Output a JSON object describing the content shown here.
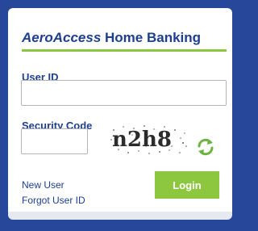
{
  "header": {
    "brand": "AeroAccess",
    "title_rest": " Home Banking"
  },
  "form": {
    "user_id_label": "User ID",
    "user_id_value": "",
    "security_code_label": "Security Code",
    "security_code_value": "",
    "captcha_text": "n2h8"
  },
  "links": {
    "new_user": "New User",
    "forgot_user_id": "Forgot User ID"
  },
  "actions": {
    "login_label": "Login"
  },
  "icons": {
    "refresh": "refresh-icon"
  },
  "colors": {
    "background": "#27479a",
    "accent": "#8dc63f",
    "text": "#1d3f8f"
  }
}
